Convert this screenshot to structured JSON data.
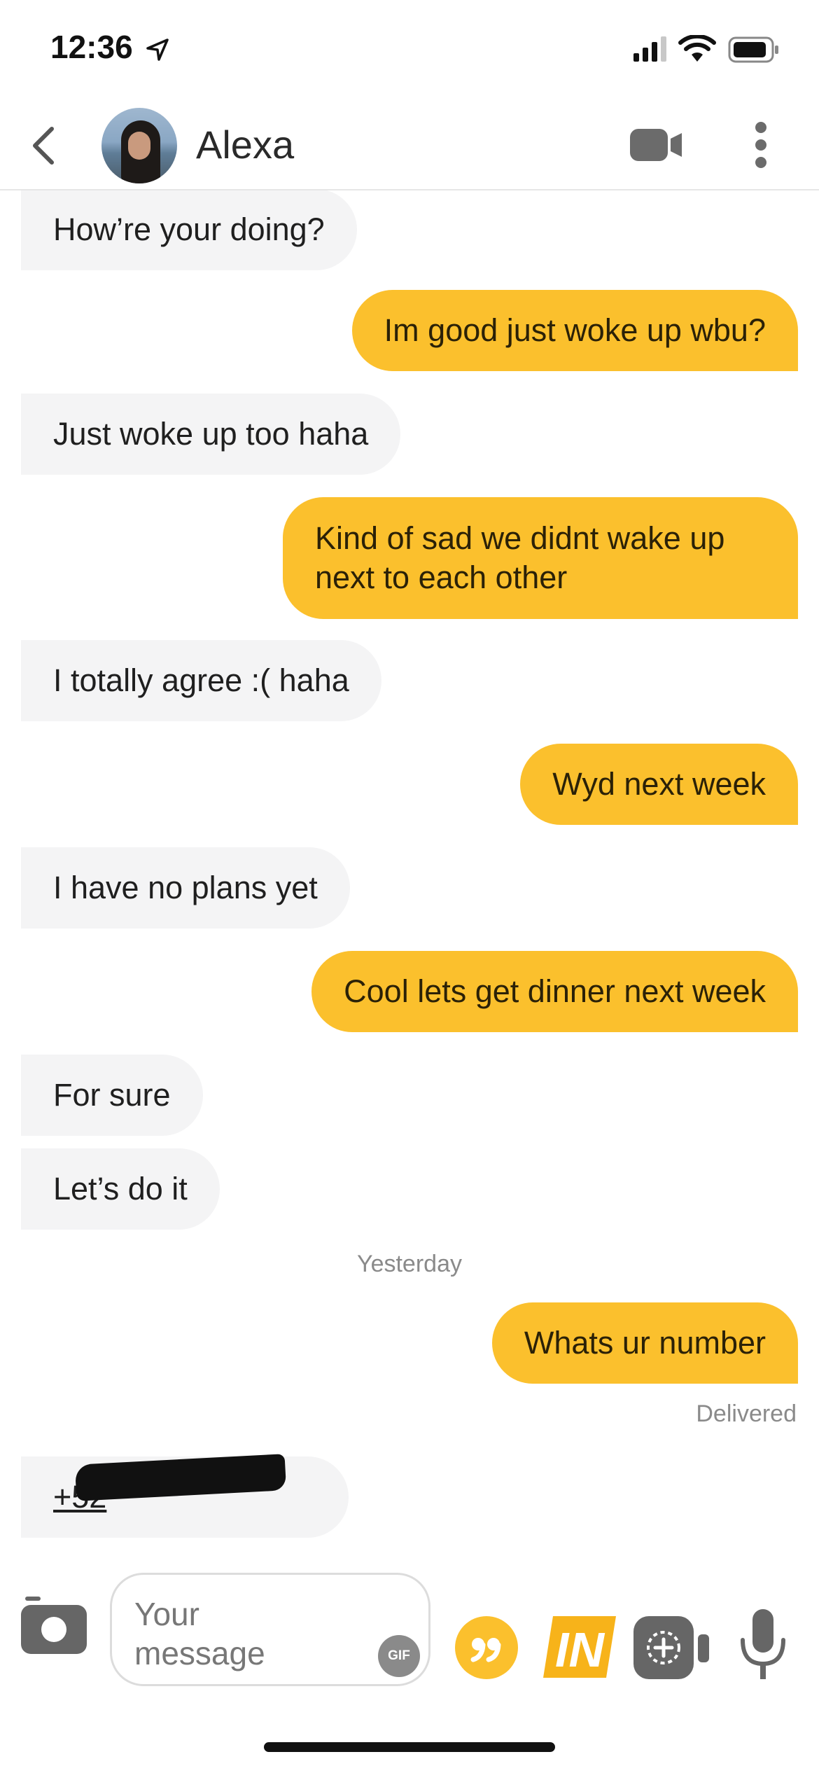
{
  "status_bar": {
    "time": "12:36"
  },
  "header": {
    "contact_name": "Alexa"
  },
  "messages": [
    {
      "dir": "in",
      "text": "How’re your doing?"
    },
    {
      "dir": "out",
      "text": "Im good just woke up wbu?"
    },
    {
      "dir": "in",
      "text": "Just woke up too haha"
    },
    {
      "dir": "out",
      "text": "Kind of sad we didnt wake up next to each other"
    },
    {
      "dir": "in",
      "text": "I totally agree :( haha"
    },
    {
      "dir": "out",
      "text": "Wyd next week"
    },
    {
      "dir": "in",
      "text": "I have no plans yet"
    },
    {
      "dir": "out",
      "text": "Cool lets get dinner next week"
    },
    {
      "dir": "in",
      "text": "For sure"
    },
    {
      "dir": "in",
      "text": "Let’s do it"
    },
    {
      "dir": "out",
      "text": "Whats ur number"
    },
    {
      "dir": "in",
      "text": "+52"
    }
  ],
  "date_separator": "Yesterday",
  "delivery_status": "Delivered",
  "composer": {
    "placeholder": "Your message",
    "gif_label": "GIF",
    "in_label": "IN"
  },
  "colors": {
    "accent": "#fbc02d",
    "incoming_bubble": "#f4f4f5",
    "meta_text": "#8a8a8a"
  }
}
